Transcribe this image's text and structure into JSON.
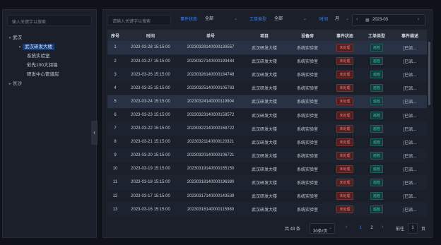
{
  "tree": {
    "search_placeholder": "输入关键字以搜索",
    "nodes": [
      {
        "label": "武汉",
        "caret": "▾"
      },
      {
        "label": "武汉研发大楼",
        "caret": "▾"
      },
      {
        "label": "系统实验室"
      },
      {
        "label": "彩先100大润墙"
      },
      {
        "label": "研发中心管道房"
      },
      {
        "label": "长沙",
        "caret": "▸"
      }
    ]
  },
  "filters": {
    "search_placeholder": "请输入关键字以搜索",
    "event_status_label": "事件状态",
    "event_status_value": "全部",
    "order_type_label": "工单类型",
    "order_type_value": "全部",
    "time_label": "时间",
    "time_unit": "月",
    "date_value": "2023-03"
  },
  "table": {
    "columns": [
      "序号",
      "时间",
      "单号",
      "项目",
      "设备房",
      "事件状态",
      "工单类型",
      "事件描述"
    ],
    "rows": [
      {
        "no": "1",
        "time": "2023-03-28 15:15:00",
        "id": "20230328140000130557",
        "project": "武汉研发大楼",
        "room": "系统实验室",
        "status": "未处理",
        "type": "巡检",
        "desc": "[已派..."
      },
      {
        "no": "2",
        "time": "2023-03-27 15:15:00",
        "id": "20230327140000193484",
        "project": "武汉研发大楼",
        "room": "系统实验室",
        "status": "未处理",
        "type": "巡检",
        "desc": "[已派..."
      },
      {
        "no": "3",
        "time": "2023-03-26 15:15:00",
        "id": "20230326140000184748",
        "project": "武汉研发大楼",
        "room": "系统实验室",
        "status": "未处理",
        "type": "巡检",
        "desc": "[已派..."
      },
      {
        "no": "4",
        "time": "2023-03-25 15:15:00",
        "id": "20230325140000105783",
        "project": "武汉研发大楼",
        "room": "系统实验室",
        "status": "未处理",
        "type": "巡检",
        "desc": "[已派..."
      },
      {
        "no": "5",
        "time": "2023-03-24 15:15:00",
        "id": "20230324140000119904",
        "project": "武汉研发大楼",
        "room": "系统实验室",
        "status": "未处理",
        "type": "巡检",
        "desc": "[已派..."
      },
      {
        "no": "6",
        "time": "2023-03-23 15:15:00",
        "id": "20230323140000158572",
        "project": "武汉研发大楼",
        "room": "系统实验室",
        "status": "未处理",
        "type": "巡检",
        "desc": "[已派..."
      },
      {
        "no": "7",
        "time": "2023-03-22 15:15:00",
        "id": "20230322140000158722",
        "project": "武汉研发大楼",
        "room": "系统实验室",
        "status": "未处理",
        "type": "巡检",
        "desc": "[已派..."
      },
      {
        "no": "8",
        "time": "2023-03-21 15:15:00",
        "id": "20230321140000120321",
        "project": "武汉研发大楼",
        "room": "系统实验室",
        "status": "未处理",
        "type": "巡检",
        "desc": "[已派..."
      },
      {
        "no": "9",
        "time": "2023-03-20 15:15:00",
        "id": "20230320140000106721",
        "project": "武汉研发大楼",
        "room": "系统实验室",
        "status": "未处理",
        "type": "巡检",
        "desc": "[已派..."
      },
      {
        "no": "10",
        "time": "2023-03-19 15:15:00",
        "id": "20230319140000155150",
        "project": "武汉研发大楼",
        "room": "系统实验室",
        "status": "未处理",
        "type": "巡检",
        "desc": "[已派..."
      },
      {
        "no": "11",
        "time": "2023-03-18 15:15:00",
        "id": "20230318140000196380",
        "project": "武汉研发大楼",
        "room": "系统实验室",
        "status": "未处理",
        "type": "巡检",
        "desc": "[已派..."
      },
      {
        "no": "12",
        "time": "2023-03-17 15:15:00",
        "id": "20230317140000143539",
        "project": "武汉研发大楼",
        "room": "系统实验室",
        "status": "未处理",
        "type": "巡检",
        "desc": "[已派..."
      },
      {
        "no": "13",
        "time": "2023-03-16 15:15:00",
        "id": "20230316140000115980",
        "project": "武汉研发大楼",
        "room": "系统实验室",
        "status": "未处理",
        "type": "巡检",
        "desc": "[已派..."
      }
    ]
  },
  "pager": {
    "total": "共 43 条",
    "page_size": "30条/页",
    "pages": [
      "1",
      "2"
    ],
    "goto_label": "前往",
    "goto_value": "1",
    "page_suffix": "页"
  },
  "colors": {
    "accent": "#3a86ff",
    "status_red": "#ff7474",
    "type_teal": "#3fd4c2"
  }
}
